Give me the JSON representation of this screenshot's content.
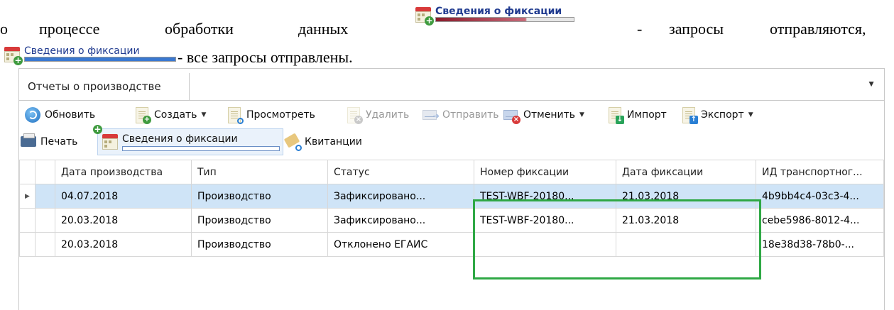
{
  "doc": {
    "line1": [
      "о",
      "процессе",
      "обработки",
      "данных",
      "-",
      "запросы",
      "отправляются,"
    ],
    "line2_text": "- все запросы отправлены.",
    "mini_label": "Сведения о фиксации"
  },
  "tab": {
    "label": "Отчеты о производстве",
    "dropdown_glyph": "▼"
  },
  "toolbar": {
    "refresh": "Обновить",
    "create": "Создать",
    "view": "Просмотреть",
    "delete": "Удалить",
    "send": "Отправить",
    "cancel": "Отменить",
    "import": "Импорт",
    "export": "Экспорт",
    "print": "Печать",
    "fixation": "Сведения о фиксации",
    "receipts": "Квитанции",
    "dd": "▼"
  },
  "table": {
    "headers": [
      "Дата производства",
      "Тип",
      "Статус",
      "Номер фиксации",
      "Дата фиксации",
      "ИД транспортног..."
    ],
    "rows": [
      [
        "04.07.2018",
        "Производство",
        "Зафиксировано...",
        "TEST-WBF-20180...",
        "21.03.2018",
        "4b9bb4c4-03c3-4..."
      ],
      [
        "20.03.2018",
        "Производство",
        "Зафиксировано...",
        "TEST-WBF-20180...",
        "21.03.2018",
        "cebe5986-8012-4..."
      ],
      [
        "20.03.2018",
        "Производство",
        "Отклонено ЕГАИС",
        "",
        "",
        "18e38d38-78b0-..."
      ]
    ],
    "row_marker": "▶"
  },
  "colors": {
    "highlight": "#2fa845",
    "selected_row": "#cfe4f7",
    "progress_fill": "#8b1c2c"
  }
}
